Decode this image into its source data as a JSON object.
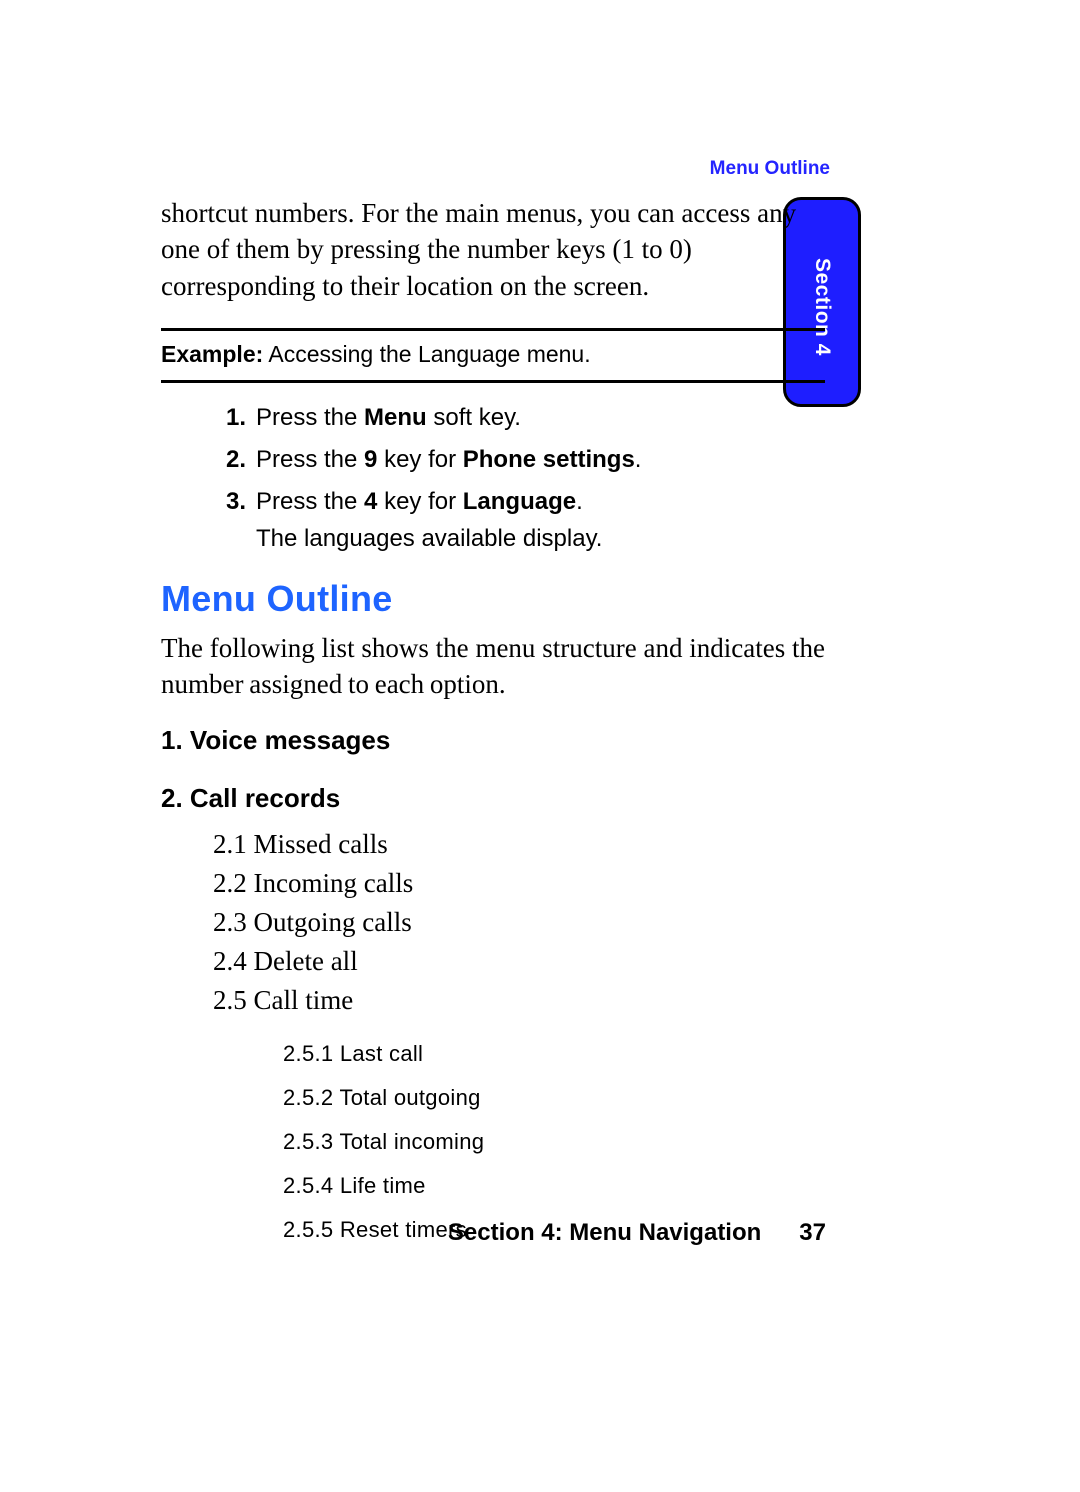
{
  "header": {
    "label": "Menu Outline"
  },
  "side_tab": {
    "label": "Section 4"
  },
  "intro": "shortcut numbers. For the main menus, you can access any one of them by pressing the number keys (1 to 0) corresponding to their location on the screen.",
  "example": {
    "label": "Example:",
    "text": " Accessing the Language menu."
  },
  "steps": [
    {
      "num": "1.",
      "pre": "Press the ",
      "b1": "Menu",
      "post": " soft key."
    },
    {
      "num": "2.",
      "pre": "Press the ",
      "b1": "9",
      "mid": " key for ",
      "b2": "Phone settings",
      "post": "."
    },
    {
      "num": "3.",
      "pre": "Press the ",
      "b1": "4",
      "mid": " key for ",
      "b2": "Language",
      "post": ".",
      "extra": "The languages available display."
    }
  ],
  "section": {
    "title": "Menu Outline",
    "intro": "The following list shows the menu structure and indicates the number assigned to each option."
  },
  "menu": {
    "item1": "1. Voice messages",
    "item2": "2. Call records",
    "sub": [
      "2.1  Missed calls",
      "2.2  Incoming calls",
      "2.3  Outgoing calls",
      "2.4  Delete all",
      "2.5  Call time"
    ],
    "subsub": [
      "2.5.1  Last call",
      "2.5.2  Total outgoing",
      "2.5.3  Total incoming",
      "2.5.4 Life time",
      "2.5.5  Reset timers"
    ]
  },
  "footer": {
    "title": "Section 4: Menu Navigation",
    "page": "37"
  }
}
